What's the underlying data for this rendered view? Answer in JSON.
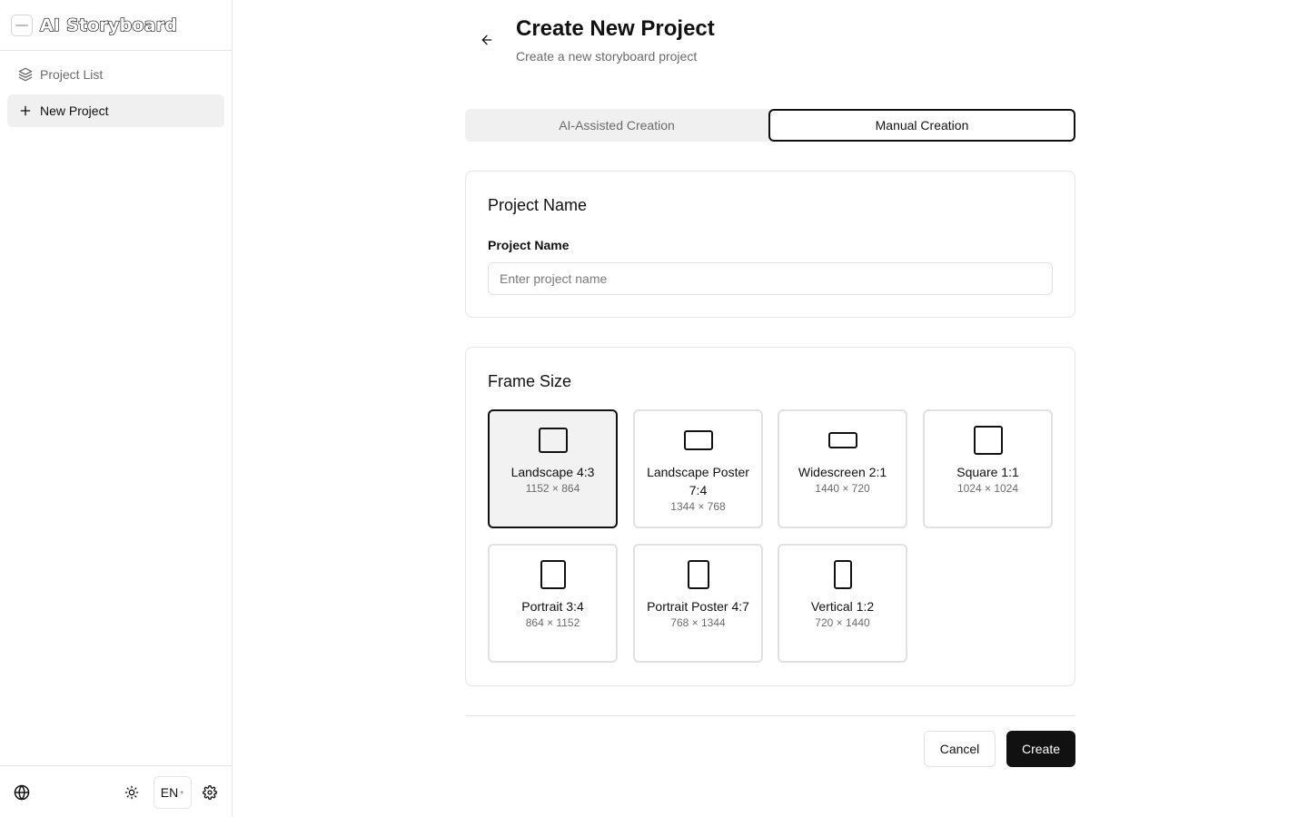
{
  "app": {
    "title": "AI Storyboard"
  },
  "sidebar": {
    "items": [
      {
        "label": "Project List",
        "icon": "layers-icon",
        "active": false
      },
      {
        "label": "New Project",
        "icon": "plus-icon",
        "active": true
      }
    ],
    "footer": {
      "language": "EN",
      "icons": [
        "globe-icon",
        "sun-icon",
        "gear-icon"
      ]
    }
  },
  "page": {
    "title": "Create New Project",
    "subtitle": "Create a new storyboard project"
  },
  "tabs": [
    {
      "label": "AI-Assisted Creation",
      "active": false
    },
    {
      "label": "Manual Creation",
      "active": true
    }
  ],
  "project_name": {
    "card_title": "Project Name",
    "label": "Project Name",
    "placeholder": "Enter project name",
    "value": ""
  },
  "frame_size": {
    "card_title": "Frame Size",
    "selected": "Landscape 4:3",
    "options": [
      {
        "label": "Landscape 4:3",
        "dims": "1152 × 864"
      },
      {
        "label": "Landscape Poster 7:4",
        "dims": "1344 × 768"
      },
      {
        "label": "Widescreen 2:1",
        "dims": "1440 × 720"
      },
      {
        "label": "Square 1:1",
        "dims": "1024 × 1024"
      },
      {
        "label": "Portrait 3:4",
        "dims": "864 × 1152"
      },
      {
        "label": "Portrait Poster 4:7",
        "dims": "768 × 1344"
      },
      {
        "label": "Vertical 1:2",
        "dims": "720 × 1440"
      }
    ]
  },
  "actions": {
    "cancel_label": "Cancel",
    "create_label": "Create"
  },
  "colors": {
    "accent": "#111111",
    "muted_text": "#6b6b6b",
    "border": "#e5e5e5",
    "active_bg": "#f0f0f0"
  }
}
